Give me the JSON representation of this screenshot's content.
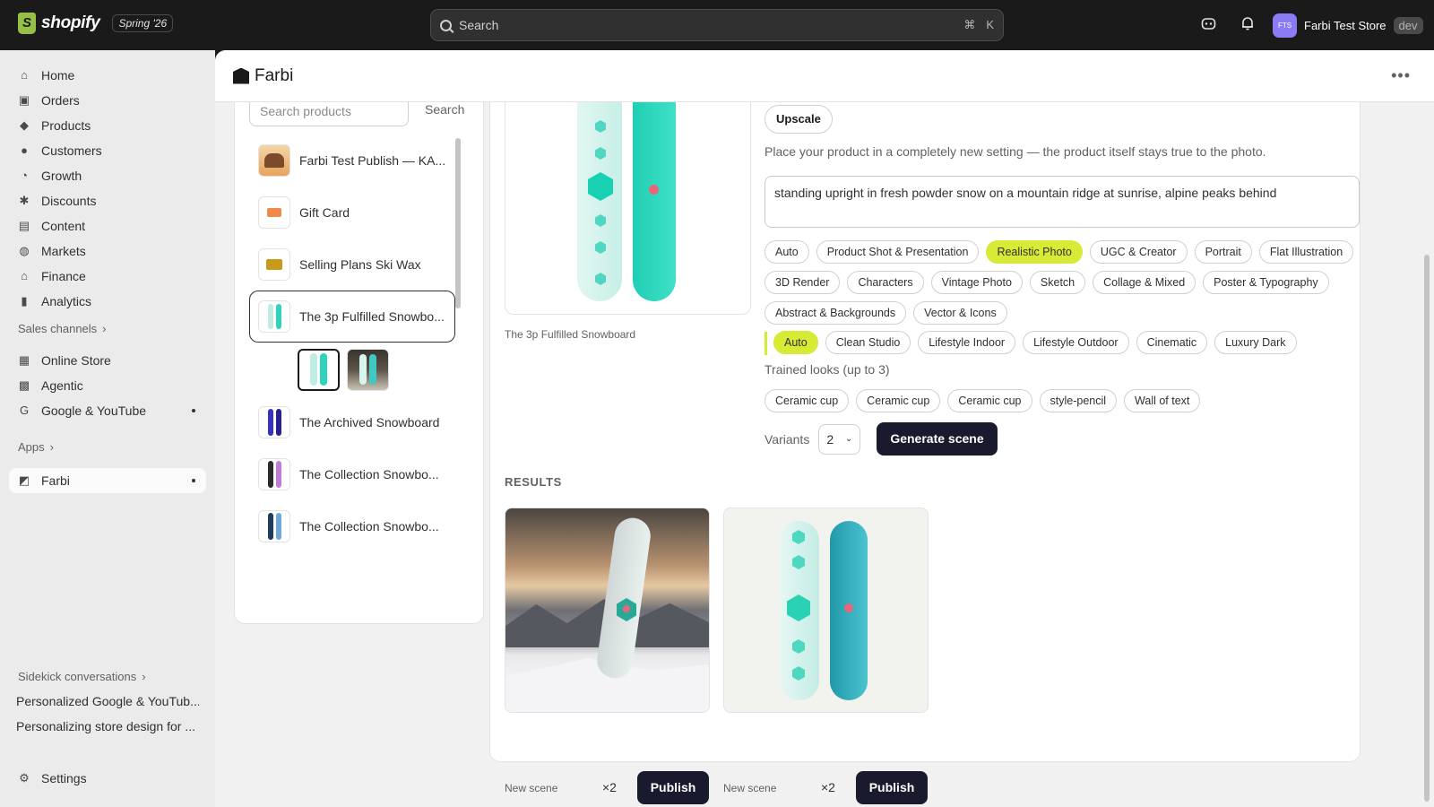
{
  "topbar": {
    "brand": "shopify",
    "edition": "Spring '26",
    "search_placeholder": "Search",
    "shortcut_cmd": "⌘",
    "shortcut_key": "K",
    "store_initials": "FTS",
    "store_name": "Farbi Test Store",
    "store_badge": "dev"
  },
  "sidebar": {
    "items": [
      {
        "label": "Home",
        "icon": "home-icon"
      },
      {
        "label": "Orders",
        "icon": "orders-icon"
      },
      {
        "label": "Products",
        "icon": "tag-icon"
      },
      {
        "label": "Customers",
        "icon": "person-icon"
      },
      {
        "label": "Growth",
        "icon": "growth-icon"
      },
      {
        "label": "Discounts",
        "icon": "discount-icon"
      },
      {
        "label": "Content",
        "icon": "content-icon"
      },
      {
        "label": "Markets",
        "icon": "globe-icon"
      },
      {
        "label": "Finance",
        "icon": "bank-icon"
      },
      {
        "label": "Analytics",
        "icon": "chart-icon"
      }
    ],
    "sales_channels_label": "Sales channels",
    "channels": [
      {
        "label": "Online Store"
      },
      {
        "label": "Agentic"
      },
      {
        "label": "Google & YouTube"
      }
    ],
    "apps_label": "Apps",
    "apps": [
      {
        "label": "Farbi"
      }
    ],
    "sidekick_label": "Sidekick conversations",
    "conversations": [
      "Personalized Google & YouTub...",
      "Personalizing store design for ..."
    ],
    "settings_label": "Settings"
  },
  "app": {
    "title": "Farbi",
    "product_search_placeholder": "Search products",
    "product_search_button": "Search",
    "products": [
      {
        "name": "Farbi Test Publish — KA..."
      },
      {
        "name": "Gift Card"
      },
      {
        "name": "Selling Plans Ski Wax"
      },
      {
        "name": "The 3p Fulfilled Snowbo..."
      },
      {
        "name": "The Archived Snowboard"
      },
      {
        "name": "The Collection Snowbo..."
      },
      {
        "name": "The Collection Snowbo..."
      }
    ],
    "selected_product_caption": "The 3p Fulfilled Snowboard",
    "upscale_label": "Upscale",
    "description": "Place your product in a completely new setting — the product itself stays true to the photo.",
    "prompt_value": "standing upright in fresh powder snow on a mountain ridge at sunrise, alpine peaks behind",
    "styles": [
      "Auto",
      "Product Shot & Presentation",
      "Realistic Photo",
      "UGC & Creator",
      "Portrait",
      "Flat Illustration",
      "3D Render",
      "Characters",
      "Vintage Photo",
      "Sketch",
      "Collage & Mixed",
      "Poster & Typography",
      "Abstract & Backgrounds",
      "Vector & Icons"
    ],
    "selected_style": "Realistic Photo",
    "substyles": [
      "Auto",
      "Clean Studio",
      "Lifestyle Indoor",
      "Lifestyle Outdoor",
      "Cinematic",
      "Luxury Dark"
    ],
    "selected_substyle": "Auto",
    "trained_label": "Trained looks (up to 3)",
    "trained_looks": [
      "Ceramic cup",
      "Ceramic cup",
      "Ceramic cup",
      "style-pencil",
      "Wall of text"
    ],
    "variants_label": "Variants",
    "variants_value": "2",
    "generate_label": "Generate scene",
    "results_label": "RESULTS",
    "results": [
      {
        "label": "New scene",
        "multiplier": "×2",
        "publish": "Publish"
      },
      {
        "label": "New scene",
        "multiplier": "×2",
        "publish": "Publish"
      }
    ]
  },
  "colors": {
    "accent_chip": "#d7ea35",
    "primary_button": "#1a1a2e",
    "board_teal": "#2fd3bc"
  }
}
